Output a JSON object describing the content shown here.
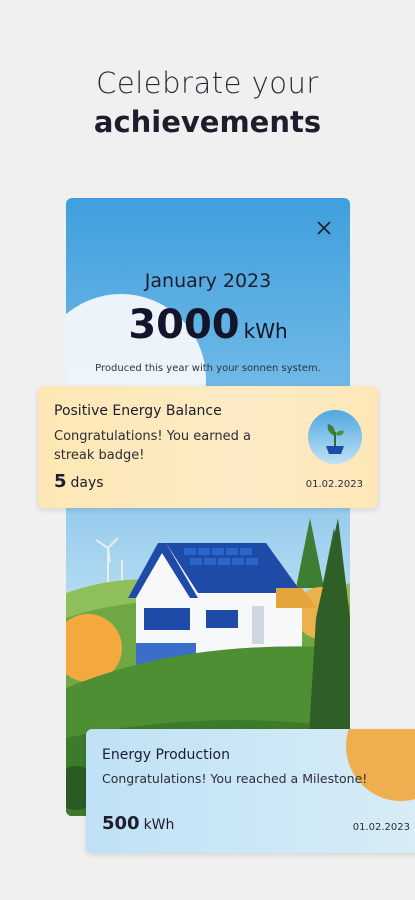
{
  "headline": {
    "line1": "Celebrate your",
    "line2": "achievements"
  },
  "summary": {
    "month": "January 2023",
    "value": "3000",
    "unit": "kWh",
    "caption": "Produced this year with your sonnen system."
  },
  "badge_card": {
    "title": "Positive Energy Balance",
    "message": "Congratulations! You earned a streak badge!",
    "count": "5",
    "count_unit": "days",
    "date": "01.02.2023"
  },
  "milestone_card": {
    "title": "Energy Production",
    "message": "Congratulations! You reached a Milestone!",
    "value": "500",
    "unit": "kWh",
    "date": "01.02.2023"
  },
  "colors": {
    "sky": "#3f9fdc",
    "card_warm": "#fde7b4",
    "card_cool": "#bfe1f5",
    "sun_orange": "#f3a93d",
    "roof_blue": "#1e4aa8"
  },
  "icons": [
    "close-icon",
    "plant-badge-icon"
  ]
}
